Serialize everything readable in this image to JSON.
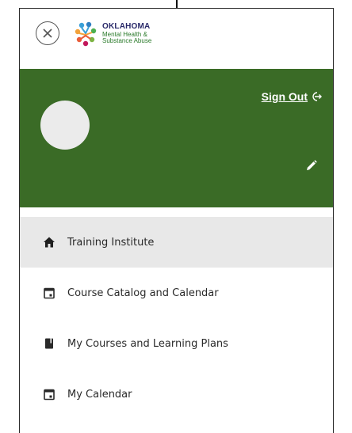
{
  "header": {
    "close_icon": "close-icon",
    "logo": {
      "line1": "OKLAHOMA",
      "line2": "Mental Health &",
      "line3": "Substance Abuse"
    }
  },
  "profile": {
    "background_color": "#3a6b26",
    "sign_out_label": "Sign Out",
    "sign_out_icon": "sign-out-icon",
    "edit_icon": "pencil-icon"
  },
  "nav": {
    "items": [
      {
        "label": "Training Institute",
        "icon": "home-icon",
        "active": true
      },
      {
        "label": "Course Catalog and Calendar",
        "icon": "calendar-icon",
        "active": false
      },
      {
        "label": "My Courses and Learning Plans",
        "icon": "book-icon",
        "active": false
      },
      {
        "label": "My Calendar",
        "icon": "calendar-icon",
        "active": false
      }
    ]
  }
}
